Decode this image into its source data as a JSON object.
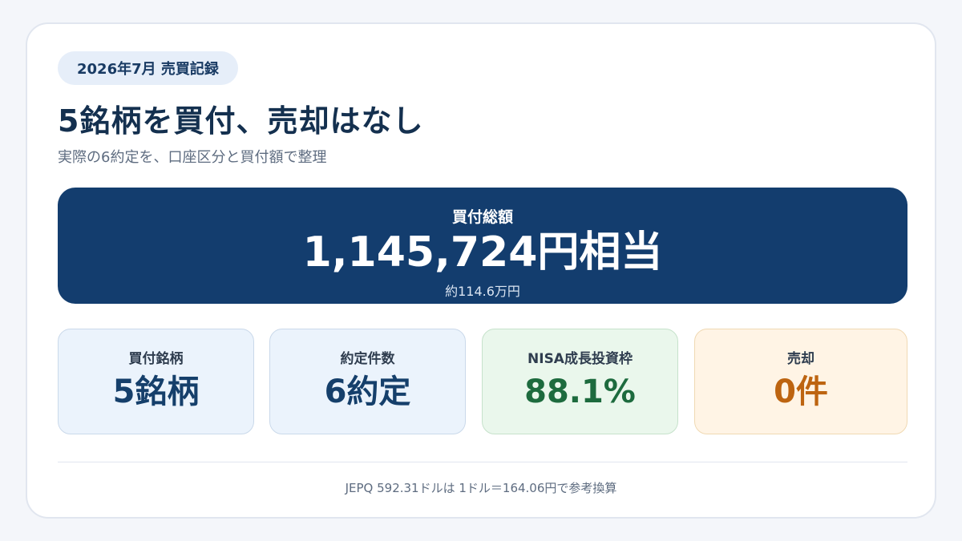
{
  "header": {
    "pill": "2026年7月 売買記録",
    "title": "5銘柄を買付、売却はなし",
    "subtitle": "実際の6約定を、口座区分と買付額で整理"
  },
  "hero": {
    "label": "買付総額",
    "value": "1,145,724円相当",
    "sub": "約114.6万円"
  },
  "stats": [
    {
      "label": "買付銘柄",
      "value": "5銘柄",
      "color": "#153f6b"
    },
    {
      "label": "約定件数",
      "value": "6約定",
      "color": "#153f6b"
    },
    {
      "label": "NISA成長投資枠",
      "value": "88.1%",
      "color": "#1d6b3e"
    },
    {
      "label": "売却",
      "value": "0件",
      "color": "#bd6410"
    }
  ],
  "footnote": "JEPQ 592.31ドルは 1ドル＝164.06円で参考換算",
  "colors": {
    "hero_bg": "#133d6e",
    "title": "#14304f",
    "pill_bg": "#e6eef9"
  }
}
